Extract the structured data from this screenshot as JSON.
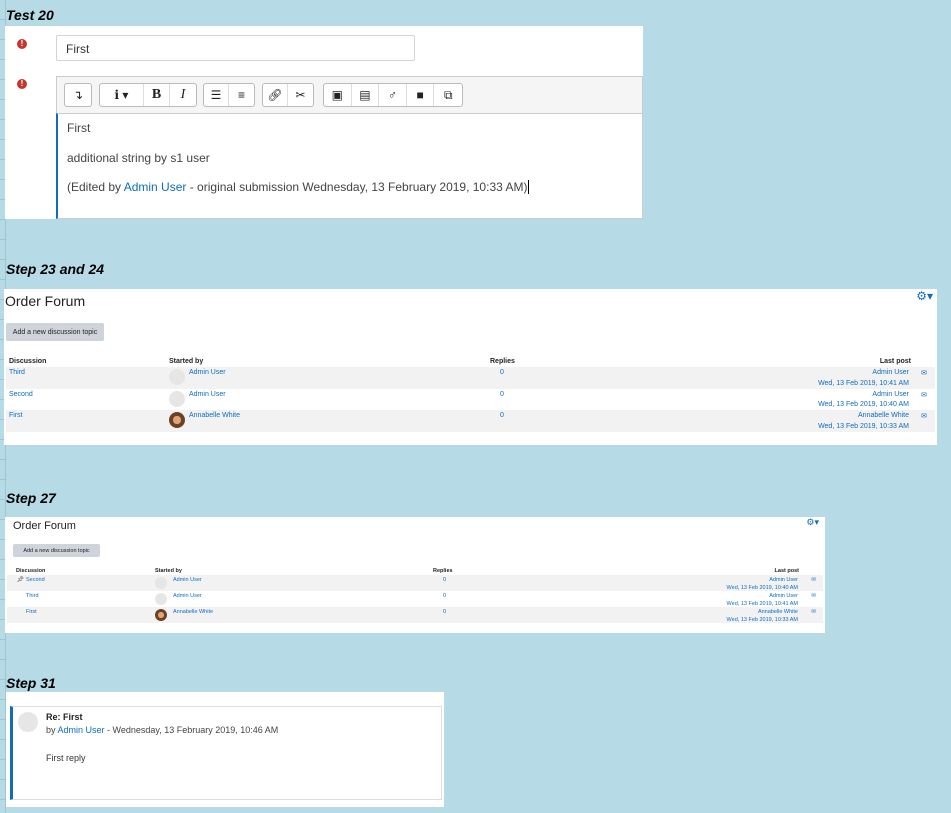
{
  "labels": {
    "test20": "Test 20",
    "step23": "Step 23 and 24",
    "step27": "Step 27",
    "step31": "Step 31"
  },
  "edit_form": {
    "subject_value": "First",
    "toolbar_icons": [
      "collapse-icon",
      "info-icon",
      "bold-icon",
      "italic-icon",
      "bullet-list-icon",
      "numbered-list-icon",
      "link-icon",
      "unlink-icon",
      "image-icon",
      "media-icon",
      "record-audio-icon",
      "record-video-icon",
      "manage-files-icon"
    ],
    "message_line1": "First",
    "message_line2": "additional string by s1 user",
    "edited_prefix": "(Edited by ",
    "edited_user": "Admin User",
    "edited_suffix": " - original submission Wednesday, 13 February 2019, 10:33 AM)"
  },
  "forum1": {
    "title": "Order Forum",
    "add_button": "Add a new discussion topic",
    "headers": {
      "discussion": "Discussion",
      "started_by": "Started by",
      "replies": "Replies",
      "last_post": "Last post"
    },
    "rows": [
      {
        "discussion": "Third",
        "pinned": false,
        "started_by": "Admin User",
        "avatar": "default",
        "replies": "0",
        "last_user": "Admin User",
        "last_date": "Wed, 13 Feb 2019, 10:41 AM"
      },
      {
        "discussion": "Second",
        "pinned": false,
        "started_by": "Admin User",
        "avatar": "default",
        "replies": "0",
        "last_user": "Admin User",
        "last_date": "Wed, 13 Feb 2019, 10:40 AM"
      },
      {
        "discussion": "First",
        "pinned": false,
        "started_by": "Annabelle White",
        "avatar": "photo",
        "replies": "0",
        "last_user": "Annabelle White",
        "last_date": "Wed, 13 Feb 2019, 10:33 AM"
      }
    ]
  },
  "forum2": {
    "title": "Order Forum",
    "add_button": "Add a new discussion topic",
    "headers": {
      "discussion": "Discussion",
      "started_by": "Started by",
      "replies": "Replies",
      "last_post": "Last post"
    },
    "rows": [
      {
        "discussion": "Second",
        "pinned": true,
        "started_by": "Admin User",
        "avatar": "default",
        "replies": "0",
        "last_user": "Admin User",
        "last_date": "Wed, 13 Feb 2019, 10:40 AM"
      },
      {
        "discussion": "Third",
        "pinned": false,
        "started_by": "Admin User",
        "avatar": "default",
        "replies": "0",
        "last_user": "Admin User",
        "last_date": "Wed, 13 Feb 2019, 10:41 AM"
      },
      {
        "discussion": "First",
        "pinned": false,
        "started_by": "Annabelle White",
        "avatar": "photo",
        "replies": "0",
        "last_user": "Annabelle White",
        "last_date": "Wed, 13 Feb 2019, 10:33 AM"
      }
    ]
  },
  "reply": {
    "subject": "Re: First",
    "by_prefix": "by ",
    "author": "Admin User",
    "date_suffix": " - Wednesday, 13 February 2019, 10:46 AM",
    "body": "First reply"
  },
  "colors": {
    "link": "#0f6cbf",
    "background": "#b6dbe6",
    "error": "#c0392b"
  }
}
